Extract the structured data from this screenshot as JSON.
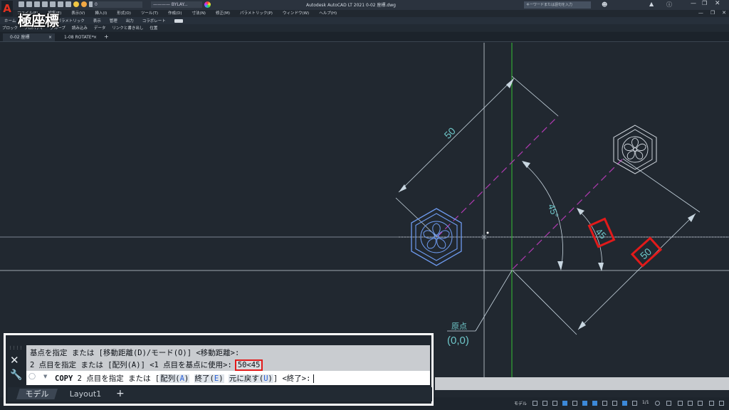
{
  "title_bar": {
    "logo": "A",
    "layer_combo": "0",
    "linetype_combo": "———— BYLAY...",
    "app_title": "Autodesk AutoCAD LT 2021    0-02 座標.dwg",
    "search_placeholder": "キーワードまたは語句を入力"
  },
  "overlay_caption": "極座標",
  "menu": [
    "ファイル(F)",
    "編集(E)",
    "表示(V)",
    "挿入(I)",
    "形式(O)",
    "ツール(T)",
    "作成(D)",
    "寸法(N)",
    "修正(M)",
    "パラメトリック(P)",
    "ウィンドウ(W)",
    "ヘルプ(H)"
  ],
  "ribbon_tabs": [
    "ホーム",
    "挿入",
    "注釈",
    "パラメトリック",
    "表示",
    "管理",
    "出力",
    "コラボレート"
  ],
  "ribbon_panels": [
    "ブロック",
    "プロパティ",
    "グループ",
    "読み込み",
    "データ",
    "リンクと書き出し",
    "位置"
  ],
  "file_tabs": {
    "tab1": "0-02 座標",
    "tab2": "1-08 ROTATE*",
    "close_glyph": "×",
    "add_glyph": "+"
  },
  "drawing": {
    "dim_top_label": "50",
    "dim_angle_label": "45°",
    "dim_angle_label_right": "45",
    "dim_right_label": "50",
    "origin_label": "原点",
    "origin_coords": "(0,0)"
  },
  "command": {
    "history_line_1": "基点を指定 または [移動距離(D)/モード(O)] <移動距離>:",
    "history_line_2": "2 点目を指定 または [配列(A)] <1 点目を基点に使用>:",
    "typed_value": "50<45",
    "prompt_command": "COPY",
    "prompt_pre": "2 点目を指定 または [",
    "opt1_text": "配列(",
    "opt1_key": "A",
    "opt2_text": "終了(",
    "opt2_key": "E",
    "opt3_text": "元に戻す(",
    "opt3_key": "U",
    "prompt_post": "] <終了>:"
  },
  "layout_tabs": [
    "モデル",
    "Layout1"
  ],
  "status": {
    "model_label": "モデル",
    "scale": "1/1"
  },
  "colors": {
    "background": "#212830",
    "dimension": "#c8d6e0",
    "dim_text": "#6ec6c8",
    "hexagon": "#6e9bf0",
    "highlight": "#e21a1a",
    "axis_green": "#35c235",
    "dash_magenta": "#b33bb3"
  }
}
